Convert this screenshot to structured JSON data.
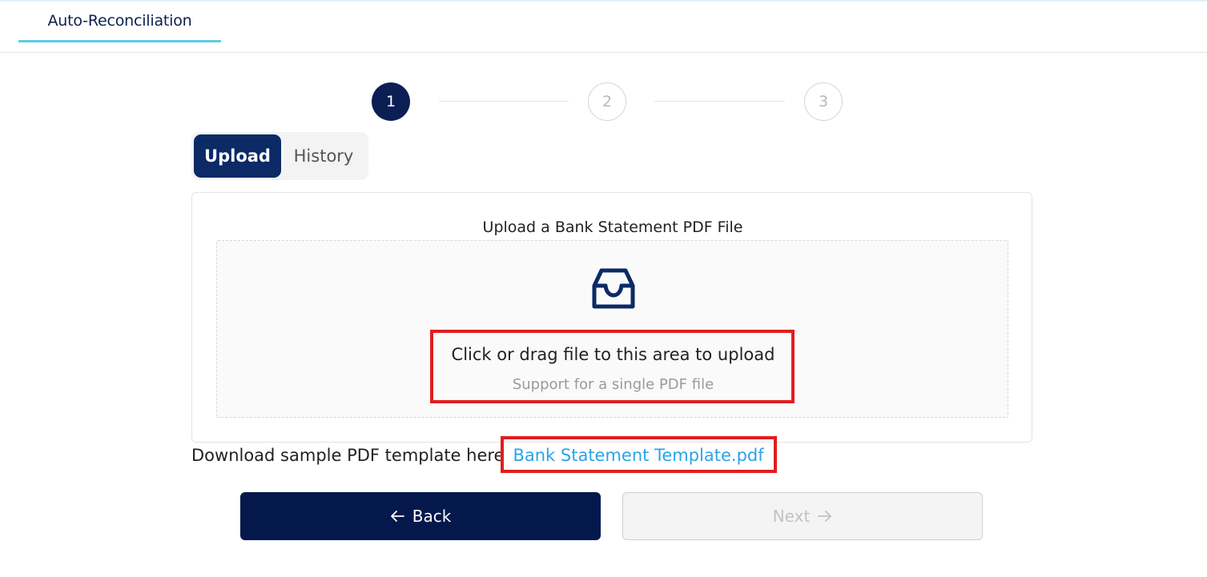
{
  "header": {
    "active_tab": "Auto-Reconciliation"
  },
  "stepper": {
    "steps": [
      "1",
      "2",
      "3"
    ],
    "current_step": 1
  },
  "segment": {
    "upload_label": "Upload",
    "history_label": "History",
    "selected": "Upload"
  },
  "upload_card": {
    "title": "Upload a Bank Statement PDF File",
    "icon": "inbox-icon",
    "drop_text": "Click or drag file to this area to upload",
    "hint_text": "Support for a single PDF file"
  },
  "download": {
    "prefix": "Download sample PDF template here",
    "link_text": "Bank Statement Template.pdf"
  },
  "buttons": {
    "back_label": "Back",
    "next_label": "Next",
    "next_disabled": true
  },
  "colors": {
    "primary_navy": "#04184c",
    "tab_underline": "#5ccbec",
    "link_blue": "#2aa3e8",
    "highlight_red": "#e01e1e"
  }
}
